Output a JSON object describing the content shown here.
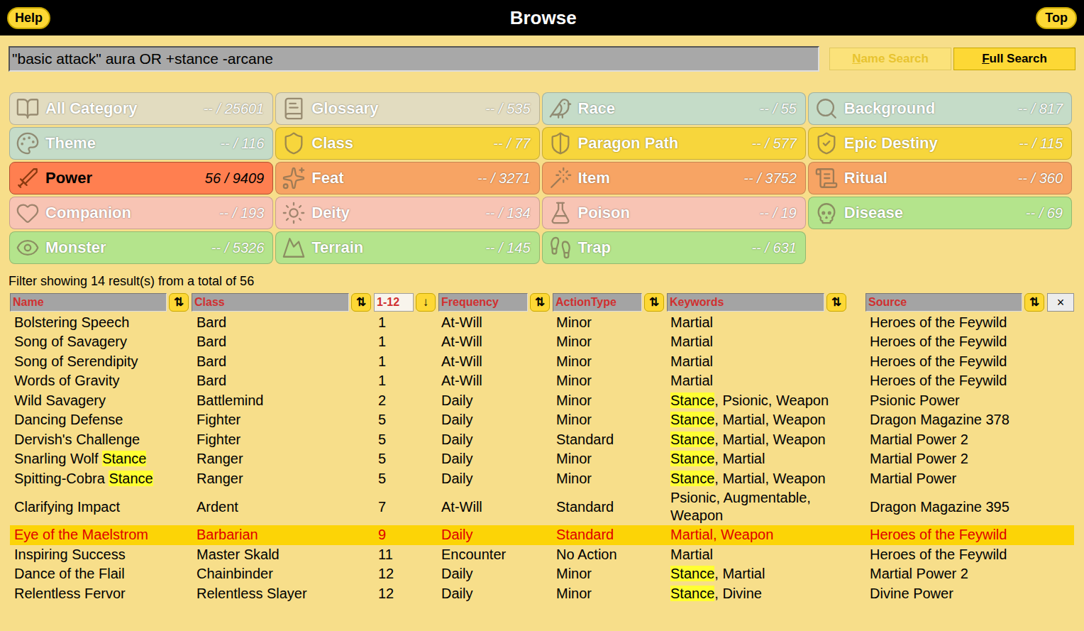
{
  "header": {
    "title": "Browse",
    "left_button": "Help",
    "right_button": "Top"
  },
  "search": {
    "value": "\"basic attack\" aura OR +stance -arcane",
    "buttons": [
      {
        "label": "Name Search",
        "selected": false,
        "disabled": true
      },
      {
        "label": "Full Search",
        "selected": true,
        "disabled": false
      }
    ]
  },
  "categories": [
    {
      "label": "All Category",
      "count": "-- / 25601",
      "color": "#e2dcc0",
      "selected": false
    },
    {
      "label": "Glossary",
      "count": "-- / 535",
      "color": "#e2dcc0",
      "selected": false
    },
    {
      "label": "Race",
      "count": "-- / 55",
      "color": "#c5dcc8",
      "selected": false
    },
    {
      "label": "Background",
      "count": "-- / 817",
      "color": "#c5dcc8",
      "selected": false
    },
    {
      "label": "Theme",
      "count": "-- / 116",
      "color": "#c5dcc8",
      "selected": false
    },
    {
      "label": "Class",
      "count": "-- / 77",
      "color": "#f7d63c",
      "selected": false
    },
    {
      "label": "Paragon Path",
      "count": "-- / 577",
      "color": "#f7d63c",
      "selected": false
    },
    {
      "label": "Epic Destiny",
      "count": "-- / 115",
      "color": "#f7d63c",
      "selected": false
    },
    {
      "label": "Power",
      "count": "56 / 9409",
      "color": "#ff7f50",
      "selected": true
    },
    {
      "label": "Feat",
      "count": "-- / 3271",
      "color": "#f7a464",
      "selected": false
    },
    {
      "label": "Item",
      "count": "-- / 3752",
      "color": "#f7a464",
      "selected": false
    },
    {
      "label": "Ritual",
      "count": "-- / 360",
      "color": "#f7a464",
      "selected": false
    },
    {
      "label": "Companion",
      "count": "-- / 193",
      "color": "#f8c4b4",
      "selected": false
    },
    {
      "label": "Deity",
      "count": "-- / 134",
      "color": "#f8c4b4",
      "selected": false
    },
    {
      "label": "Poison",
      "count": "-- / 19",
      "color": "#f8c4b4",
      "selected": false
    },
    {
      "label": "Disease",
      "count": "-- / 69",
      "color": "#b4e48c",
      "selected": false
    },
    {
      "label": "Monster",
      "count": "-- / 5326",
      "color": "#b4e48c",
      "selected": false
    },
    {
      "label": "Terrain",
      "count": "-- / 145",
      "color": "#b4e48c",
      "selected": false
    },
    {
      "label": "Trap",
      "count": "-- / 631",
      "color": "#b4e48c",
      "selected": false
    }
  ],
  "filter_status": "Filter showing 14 result(s) from a total of 56",
  "table": {
    "columns": [
      {
        "label": "Name",
        "sort": "⇅",
        "kind": "sort"
      },
      {
        "label": "Class",
        "sort": "⇅",
        "kind": "sort"
      },
      {
        "label": "1-12",
        "sort": "↓",
        "kind": "filter"
      },
      {
        "label": "Frequency",
        "sort": "⇅",
        "kind": "sort"
      },
      {
        "label": "ActionType",
        "sort": "⇅",
        "kind": "sort"
      },
      {
        "label": "Keywords",
        "sort": "⇅",
        "kind": "sort"
      },
      {
        "label": "Source",
        "sort": "⇅",
        "kind": "sort"
      }
    ],
    "clear_button": "×",
    "rows": [
      {
        "name": [
          {
            "text": "Bolstering Speech",
            "highlight": false
          }
        ],
        "class": "Bard",
        "level": "1",
        "frequency": "At-Will",
        "action": "Minor",
        "keywords": [
          {
            "text": "Martial",
            "highlight": false
          }
        ],
        "source": "Heroes of the Feywild",
        "selected": false
      },
      {
        "name": [
          {
            "text": "Song of Savagery",
            "highlight": false
          }
        ],
        "class": "Bard",
        "level": "1",
        "frequency": "At-Will",
        "action": "Minor",
        "keywords": [
          {
            "text": "Martial",
            "highlight": false
          }
        ],
        "source": "Heroes of the Feywild",
        "selected": false
      },
      {
        "name": [
          {
            "text": "Song of Serendipity",
            "highlight": false
          }
        ],
        "class": "Bard",
        "level": "1",
        "frequency": "At-Will",
        "action": "Minor",
        "keywords": [
          {
            "text": "Martial",
            "highlight": false
          }
        ],
        "source": "Heroes of the Feywild",
        "selected": false
      },
      {
        "name": [
          {
            "text": "Words of Gravity",
            "highlight": false
          }
        ],
        "class": "Bard",
        "level": "1",
        "frequency": "At-Will",
        "action": "Minor",
        "keywords": [
          {
            "text": "Martial",
            "highlight": false
          }
        ],
        "source": "Heroes of the Feywild",
        "selected": false
      },
      {
        "name": [
          {
            "text": "Wild Savagery",
            "highlight": false
          }
        ],
        "class": "Battlemind",
        "level": "2",
        "frequency": "Daily",
        "action": "Minor",
        "keywords": [
          {
            "text": "Stance",
            "highlight": true
          },
          {
            "text": ", Psionic, Weapon",
            "highlight": false
          }
        ],
        "source": "Psionic Power",
        "selected": false
      },
      {
        "name": [
          {
            "text": "Dancing Defense",
            "highlight": false
          }
        ],
        "class": "Fighter",
        "level": "5",
        "frequency": "Daily",
        "action": "Minor",
        "keywords": [
          {
            "text": "Stance",
            "highlight": true
          },
          {
            "text": ", Martial, Weapon",
            "highlight": false
          }
        ],
        "source": "Dragon Magazine 378",
        "selected": false
      },
      {
        "name": [
          {
            "text": "Dervish's Challenge",
            "highlight": false
          }
        ],
        "class": "Fighter",
        "level": "5",
        "frequency": "Daily",
        "action": "Standard",
        "keywords": [
          {
            "text": "Stance",
            "highlight": true
          },
          {
            "text": ", Martial, Weapon",
            "highlight": false
          }
        ],
        "source": "Martial Power 2",
        "selected": false
      },
      {
        "name": [
          {
            "text": "Snarling Wolf ",
            "highlight": false
          },
          {
            "text": "Stance",
            "highlight": true
          }
        ],
        "class": "Ranger",
        "level": "5",
        "frequency": "Daily",
        "action": "Minor",
        "keywords": [
          {
            "text": "Stance",
            "highlight": true
          },
          {
            "text": ", Martial",
            "highlight": false
          }
        ],
        "source": "Martial Power 2",
        "selected": false
      },
      {
        "name": [
          {
            "text": "Spitting-Cobra ",
            "highlight": false
          },
          {
            "text": "Stance",
            "highlight": true
          }
        ],
        "class": "Ranger",
        "level": "5",
        "frequency": "Daily",
        "action": "Minor",
        "keywords": [
          {
            "text": "Stance",
            "highlight": true
          },
          {
            "text": ", Martial, Weapon",
            "highlight": false
          }
        ],
        "source": "Martial Power",
        "selected": false
      },
      {
        "name": [
          {
            "text": "Clarifying Impact",
            "highlight": false
          }
        ],
        "class": "Ardent",
        "level": "7",
        "frequency": "At-Will",
        "action": "Standard",
        "keywords": [
          {
            "text": "Psionic, Augmentable, Weapon",
            "highlight": false
          }
        ],
        "source": "Dragon Magazine 395",
        "selected": false
      },
      {
        "name": [
          {
            "text": "Eye of the Maelstrom",
            "highlight": false
          }
        ],
        "class": "Barbarian",
        "level": "9",
        "frequency": "Daily",
        "action": "Standard",
        "keywords": [
          {
            "text": "Martial, Weapon",
            "highlight": false
          }
        ],
        "source": "Heroes of the Feywild",
        "selected": true
      },
      {
        "name": [
          {
            "text": "Inspiring Success",
            "highlight": false
          }
        ],
        "class": "Master Skald",
        "level": "11",
        "frequency": "Encounter",
        "action": "No Action",
        "keywords": [
          {
            "text": "Martial",
            "highlight": false
          }
        ],
        "source": "Heroes of the Feywild",
        "selected": false
      },
      {
        "name": [
          {
            "text": "Dance of the Flail",
            "highlight": false
          }
        ],
        "class": "Chainbinder",
        "level": "12",
        "frequency": "Daily",
        "action": "Minor",
        "keywords": [
          {
            "text": "Stance",
            "highlight": true
          },
          {
            "text": ", Martial",
            "highlight": false
          }
        ],
        "source": "Martial Power 2",
        "selected": false
      },
      {
        "name": [
          {
            "text": "Relentless Fervor",
            "highlight": false
          }
        ],
        "class": "Relentless Slayer",
        "level": "12",
        "frequency": "Daily",
        "action": "Minor",
        "keywords": [
          {
            "text": "Stance",
            "highlight": true
          },
          {
            "text": ", Divine",
            "highlight": false
          }
        ],
        "source": "Divine Power",
        "selected": false
      }
    ]
  }
}
